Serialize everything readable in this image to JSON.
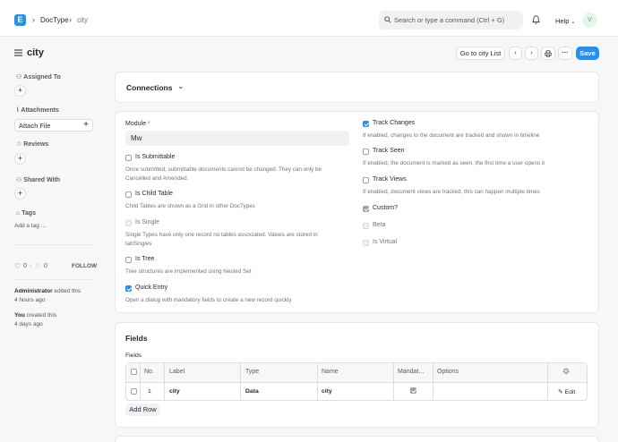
{
  "navbar": {
    "logo_letter": "E",
    "breadcrumbs": [
      "DocType",
      "city"
    ],
    "search_placeholder": "Search or type a command (Ctrl + G)",
    "help_label": "Help",
    "avatar_initial": "V"
  },
  "page": {
    "title": "city",
    "go_to_list_label": "Go to city List",
    "more_label": "···",
    "save_label": "Save"
  },
  "sidebar": {
    "assigned_to": "Assigned To",
    "attachments": "Attachments",
    "attach_file": "Attach File",
    "reviews": "Reviews",
    "shared_with": "Shared With",
    "tags": "Tags",
    "add_tag": "Add a tag ...",
    "likes": "0",
    "comments": "0",
    "follow": "FOLLOW",
    "activity": [
      {
        "user": "Administrator",
        "action": " edited this",
        "time": "4 hours ago"
      },
      {
        "user": "You",
        "action": " created this",
        "time": "4 days ago"
      }
    ]
  },
  "connections": {
    "title": "Connections"
  },
  "form": {
    "module_label": "Module",
    "module_required": "*",
    "module_value": "Mw",
    "is_submittable": {
      "label": "Is Submittable",
      "checked": false,
      "desc1": "Once submitted, submittable documents cannot be changed. They can only be",
      "desc2": "Cancelled and Amended."
    },
    "is_child_table": {
      "label": "Is Child Table",
      "checked": false,
      "desc1": "Child Tables are shown as a Grid in other DocTypes"
    },
    "is_single": {
      "label": "Is Single",
      "checked": false,
      "desc1": "Single Types have only one record no tables associated. Values are stored in",
      "desc2": "tabSingles"
    },
    "is_tree": {
      "label": "Is Tree",
      "checked": false,
      "desc1": "Tree structures are implemented using Nested Set"
    },
    "quick_entry": {
      "label": "Quick Entry",
      "checked": true,
      "desc1": "Open a dialog with mandatory fields to create a new record quickly"
    },
    "track_changes": {
      "label": "Track Changes",
      "checked": true,
      "desc1": "If enabled, changes to the document are tracked and shown in timeline"
    },
    "track_seen": {
      "label": "Track Seen",
      "checked": false,
      "desc1": "If enabled, the document is marked as seen, the first time a user opens it"
    },
    "track_views": {
      "label": "Track Views",
      "checked": false,
      "desc1": "If enabled, document views are tracked, this can happen multiple times"
    },
    "custom": {
      "label": "Custom?",
      "checked": true
    },
    "beta": {
      "label": "Beta",
      "checked": false
    },
    "is_virtual": {
      "label": "Is Virtual",
      "checked": false
    }
  },
  "fields_section": {
    "title": "Fields",
    "table_label": "Fields",
    "columns": [
      "No.",
      "Label",
      "Type",
      "Name",
      "Mandat...",
      "Options"
    ],
    "rows": [
      {
        "no": "1",
        "label": "city",
        "type": "Data",
        "name": "city",
        "mandatory": true,
        "edit": "Edit"
      }
    ],
    "add_row": "Add Row"
  },
  "colors": {
    "primary": "#2490ef",
    "background": "#f7f7f7",
    "card": "#ffffff",
    "border": "#e5e7ea"
  }
}
